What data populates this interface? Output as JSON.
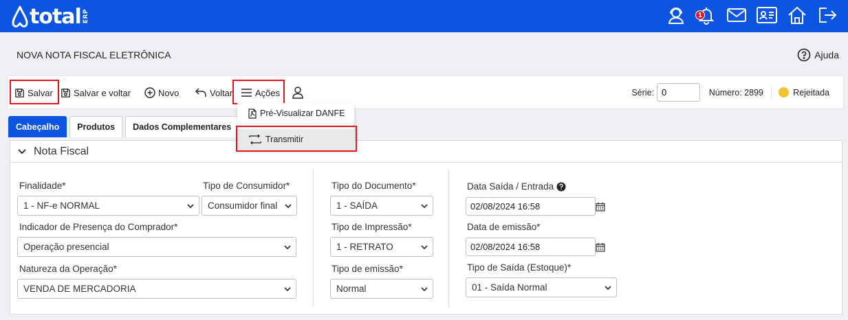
{
  "brand": {
    "word": "total",
    "erp": "ERP",
    "bar_color": "#0b55e0"
  },
  "header": {
    "icons": [
      "support-icon",
      "bell-icon",
      "mail-icon",
      "contact-card-icon",
      "home-icon",
      "logout-icon"
    ],
    "notification_count": "1"
  },
  "page": {
    "title": "NOVA NOTA FISCAL ELETRÔNICA",
    "help_label": "Ajuda"
  },
  "toolbar": {
    "save_label": "Salvar",
    "save_back_label": "Salvar e voltar",
    "new_label": "Novo",
    "back_label": "Voltar",
    "actions_label": "Ações",
    "serie_label": "Série:",
    "serie_value": "0",
    "numero_label": "Número: 2899",
    "status_label": "Rejeitada",
    "status_color": "#f1c232"
  },
  "actions_menu": {
    "items": [
      {
        "label": "Pré-Visualizar DANFE",
        "icon": "pdf-icon"
      },
      {
        "label": "Transmitir",
        "icon": "transmit-icon"
      }
    ]
  },
  "tabs": [
    "Cabeçalho",
    "Produtos",
    "Dados Complementares"
  ],
  "section": {
    "title": "Nota Fiscal",
    "finalidade": {
      "label": "Finalidade*",
      "value": "1 - NF-e NORMAL"
    },
    "tipo_consumidor": {
      "label": "Tipo de Consumidor*",
      "value": "Consumidor final"
    },
    "indicador_presenca": {
      "label": "Indicador de Presença do Comprador*",
      "value": "Operação presencial"
    },
    "natureza_operacao": {
      "label": "Natureza da Operação*",
      "value": "VENDA DE MERCADORIA"
    },
    "tipo_documento": {
      "label": "Tipo do Documento*",
      "value": "1 - SAÍDA"
    },
    "tipo_impressao": {
      "label": "Tipo de Impressão*",
      "value": "1 - RETRATO"
    },
    "tipo_emissao": {
      "label": "Tipo de emissão*",
      "value": "Normal"
    },
    "data_saida": {
      "label": "Data Saída / Entrada",
      "value": "02/08/2024 16:58"
    },
    "data_emissao": {
      "label": "Data de emissão*",
      "value": "02/08/2024 16:58"
    },
    "tipo_saida": {
      "label": "Tipo de Saída (Estoque)*",
      "value": "01 - Saída Normal"
    }
  }
}
